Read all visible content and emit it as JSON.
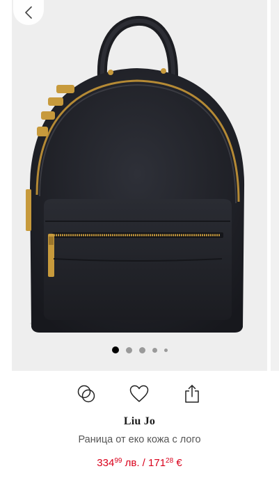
{
  "gallery": {
    "image_alt": "Раница от еко кожа с лого",
    "slide_count": 5,
    "active_slide": 1
  },
  "actions": {
    "compare_icon": "compare-circles-icon",
    "wishlist_icon": "heart-icon",
    "share_icon": "share-icon"
  },
  "product": {
    "brand": "Liu Jo",
    "name": "Раница от еко кожа с лого",
    "price_bgn_whole": "334",
    "price_bgn_cents": "99",
    "price_bgn_unit": " лв. / ",
    "price_eur_whole": "171",
    "price_eur_cents": "28",
    "price_eur_unit": " €"
  },
  "colors": {
    "price": "#d9001b",
    "bag": "#24252c",
    "hardware": "#c79a3c",
    "photo_background": "#eeeeee"
  }
}
